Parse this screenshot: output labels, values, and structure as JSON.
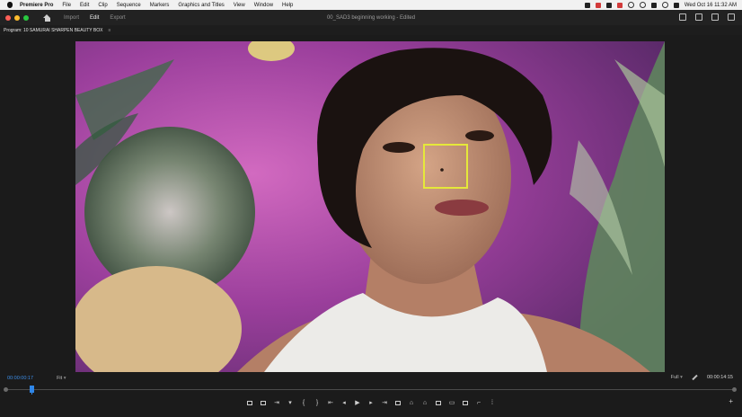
{
  "menubar": {
    "app_name": "Premiere Pro",
    "items": [
      "File",
      "Edit",
      "Clip",
      "Sequence",
      "Markers",
      "Graphics and Titles",
      "View",
      "Window",
      "Help"
    ],
    "clock": "Wed Oct 16  11:32 AM"
  },
  "header": {
    "tabs": [
      {
        "label": "Import",
        "active": false
      },
      {
        "label": "Edit",
        "active": true
      },
      {
        "label": "Export",
        "active": false
      }
    ],
    "document_title": "00_SAD3 beginning working - Edited"
  },
  "program_panel": {
    "tab_label": "Program: 10 SAMURAI SHARPEN BEAUTY BOX",
    "menu_icon": "≡"
  },
  "viewer": {
    "focus_box_color": "#e5e83a",
    "background_color": "#8a3b90"
  },
  "timecode": {
    "current": "00:00:00:17",
    "zoom": "Fit",
    "resolution": "Full",
    "duration": "00:00:14:15",
    "current_color": "#3d8ee8"
  },
  "playhead": {
    "position_fraction": 0.036
  },
  "transport": {
    "buttons": [
      "insert-icon",
      "lift-icon",
      "extract-icon",
      "marker-icon",
      "in-point-icon",
      "out-point-icon",
      "go-to-in-icon",
      "step-back-icon",
      "play-icon",
      "step-forward-icon",
      "go-to-out-icon",
      "loop-icon",
      "safe-margins-icon",
      "overlay-icon",
      "vr-icon",
      "compare-icon",
      "export-frame-icon",
      "proxy-icon",
      "multicam-icon",
      "button-editor-icon"
    ]
  }
}
